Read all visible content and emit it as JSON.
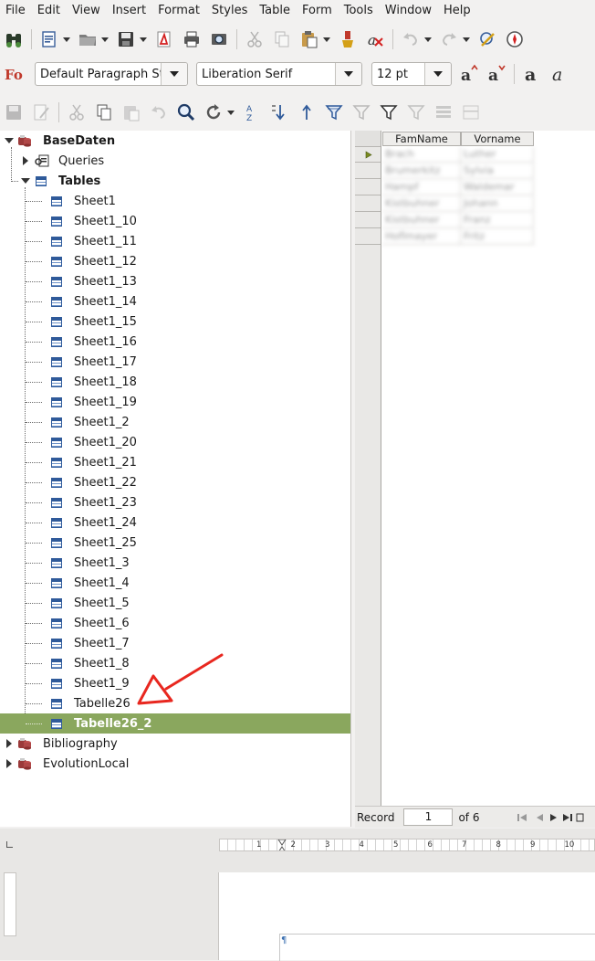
{
  "menu": [
    "File",
    "Edit",
    "View",
    "Insert",
    "Format",
    "Styles",
    "Table",
    "Form",
    "Tools",
    "Window",
    "Help"
  ],
  "toolbar2": {
    "paragraph_style": "Default Paragraph St",
    "font_name": "Liberation Serif",
    "font_size": "12 pt"
  },
  "tree": {
    "root": "BaseDaten",
    "queries": "Queries",
    "tables": "Tables",
    "table_items": [
      "Sheet1",
      "Sheet1_10",
      "Sheet1_11",
      "Sheet1_12",
      "Sheet1_13",
      "Sheet1_14",
      "Sheet1_15",
      "Sheet1_16",
      "Sheet1_17",
      "Sheet1_18",
      "Sheet1_19",
      "Sheet1_2",
      "Sheet1_20",
      "Sheet1_21",
      "Sheet1_22",
      "Sheet1_23",
      "Sheet1_24",
      "Sheet1_25",
      "Sheet1_3",
      "Sheet1_4",
      "Sheet1_5",
      "Sheet1_6",
      "Sheet1_7",
      "Sheet1_8",
      "Sheet1_9",
      "Tabelle26",
      "Tabelle26_2"
    ],
    "selected": "Tabelle26_2",
    "other_dbs": [
      "Bibliography",
      "EvolutionLocal"
    ]
  },
  "grid": {
    "columns": [
      "FamName",
      "Vorname"
    ],
    "rows": [
      [
        "Brach",
        "Luther"
      ],
      [
        "Brumerkitz",
        "Sylvia"
      ],
      [
        "Hampf",
        "Waldemar"
      ],
      [
        "Kistbuhner",
        "Johann"
      ],
      [
        "Kistbuhner",
        "Franz"
      ],
      [
        "Hoflmayer",
        "Fritz"
      ]
    ]
  },
  "record_bar": {
    "label": "Record",
    "current": "1",
    "of_label": "of 6"
  },
  "ruler_numbers": [
    "1",
    "1",
    "2",
    "3",
    "4",
    "5",
    "6",
    "7",
    "8",
    "9",
    "10"
  ],
  "pilcrow": "¶",
  "colors": {
    "selection": "#8aa75e",
    "annotation_arrow": "#e8271f"
  }
}
